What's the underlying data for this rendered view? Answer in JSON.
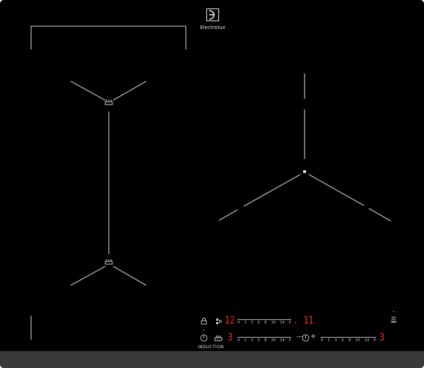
{
  "brand": {
    "name": "Electrolux"
  },
  "controls": {
    "lock_icon": "lock-icon",
    "bridge_icon": "bridge-icon",
    "power_icon": "power-icon",
    "pot_icon": "pot-icon",
    "timer_icon": "timer-icon",
    "hood_icon": "hood-icon",
    "induction_label": "INDUCTION",
    "top_row_level": "12",
    "top_row_timer": ". 11",
    "bottom_left_level": "3",
    "bottom_right_level": "3",
    "timer_minus": "—",
    "timer_plus": "+",
    "scale_marks": [
      "0",
      "1",
      "3",
      "5",
      "8",
      "10",
      "14",
      "P"
    ],
    "display_color": "#ff2a1d"
  }
}
